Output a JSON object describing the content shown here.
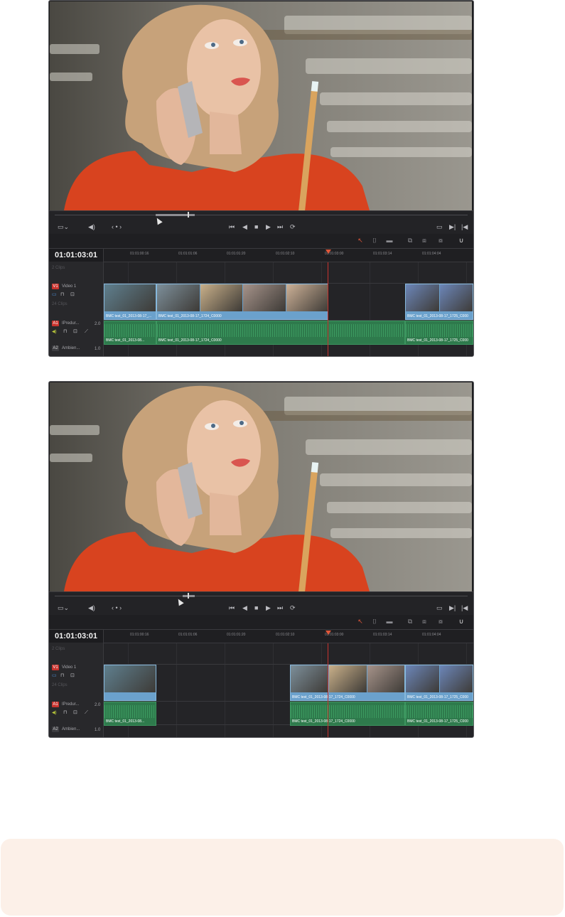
{
  "timelines": [
    {
      "id": "before",
      "timecode": "01:01:03:01",
      "ruler": [
        "01:01:00:16",
        "01:01:01:06",
        "01:01:01:20",
        "01:01:02:10",
        "01:01:03:00",
        "01:01:03:14",
        "01:01:04:04"
      ],
      "track_v1": {
        "tag": "V1",
        "name": "Video 1",
        "clips_count": "2 Clips"
      },
      "track_v1_sub": "24 Clips",
      "track_a1": {
        "tag": "A1",
        "name": "IPredur...",
        "level": "2.0"
      },
      "track_a2": {
        "tag": "A2",
        "name": "Ambien...",
        "level": "1.0"
      },
      "video_clips": [
        {
          "label": "BMC test_01_2013-08-17_..."
        },
        {
          "label": "BMC test_01_2013-08-17_1724_C0000"
        },
        {
          "label": "BMC test_01_2013-08-17_1725_C000"
        }
      ],
      "audio_clips": [
        {
          "label": "BMC test_01_2013-08..."
        },
        {
          "label": "BMC test_01_2013-08-17_1724_C0000"
        },
        {
          "label": "BMC test_01_2013-08-17_1725_C000"
        }
      ]
    },
    {
      "id": "after",
      "timecode": "01:01:03:01",
      "ruler": [
        "01:01:00:16",
        "01:01:01:06",
        "01:01:01:20",
        "01:01:02:10",
        "01:01:03:00",
        "01:01:03:14",
        "01:01:04:04"
      ],
      "track_v1": {
        "tag": "V1",
        "name": "Video 1",
        "clips_count": "2 Clips"
      },
      "track_v1_sub": "24 Clips",
      "track_a1": {
        "tag": "A1",
        "name": "IPredur...",
        "level": "2.0"
      },
      "track_a2": {
        "tag": "A2",
        "name": "Ambien...",
        "level": "1.0"
      },
      "video_clips": [
        {
          "label": ""
        },
        {
          "label": "BMC test_01_2013-08-17_1724_C0000"
        },
        {
          "label": "BMC test_01_2013-08-17_1725_C000"
        }
      ],
      "audio_clips": [
        {
          "label": "BMC test_01_2013-08..."
        },
        {
          "label": "BMC test_01_2013-08-17_1724_C0000"
        },
        {
          "label": "BMC test_01_2013-08-17_1725_C000"
        }
      ]
    }
  ],
  "colors": {
    "accent": "#e0573a",
    "video_clip": "#6ba1cc",
    "audio_clip": "#2e7a4c",
    "note_bg": "#fcf0e8"
  },
  "icons": [
    "monitor-icon",
    "speaker-icon",
    "jog-icon",
    "skip-start-icon",
    "play-reverse-icon",
    "stop-icon",
    "play-icon",
    "skip-end-icon",
    "loop-icon",
    "arrow-tool-icon",
    "trim-tool-icon",
    "blade-tool-icon",
    "insert-icon",
    "overwrite-icon",
    "replace-icon",
    "snap-icon"
  ]
}
